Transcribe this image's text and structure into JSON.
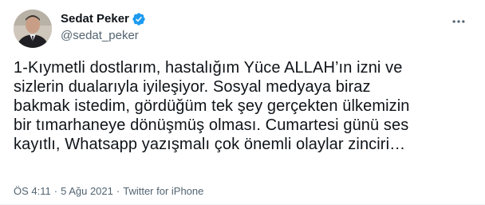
{
  "author": {
    "display_name": "Sedat Peker",
    "handle": "@sedat_peker",
    "verified": true
  },
  "tweet": {
    "text": "1-Kıymetli dostlarım, hastalığım Yüce ALLAH’ın izni ve\nsizlerin dualarıyla iyileşiyor. Sosyal medyaya biraz\nbakmak istedim, gördüğüm tek şey gerçekten ülkemizin\nbir tımarhaneye dönüşmüş olması. Cumartesi günü ses\nkayıtlı, Whatsapp yazışmalı çok önemli olaylar zinciri…"
  },
  "meta": {
    "time": "ÖS 4:11",
    "date": "5 Ağu 2021",
    "source": "Twitter for iPhone",
    "separator": "·"
  },
  "icons": {
    "verified": "verified-badge-icon",
    "more": "more-dots-icon"
  },
  "colors": {
    "text_primary": "#0f1419",
    "text_secondary": "#536471",
    "verified_blue": "#1d9bf0"
  }
}
